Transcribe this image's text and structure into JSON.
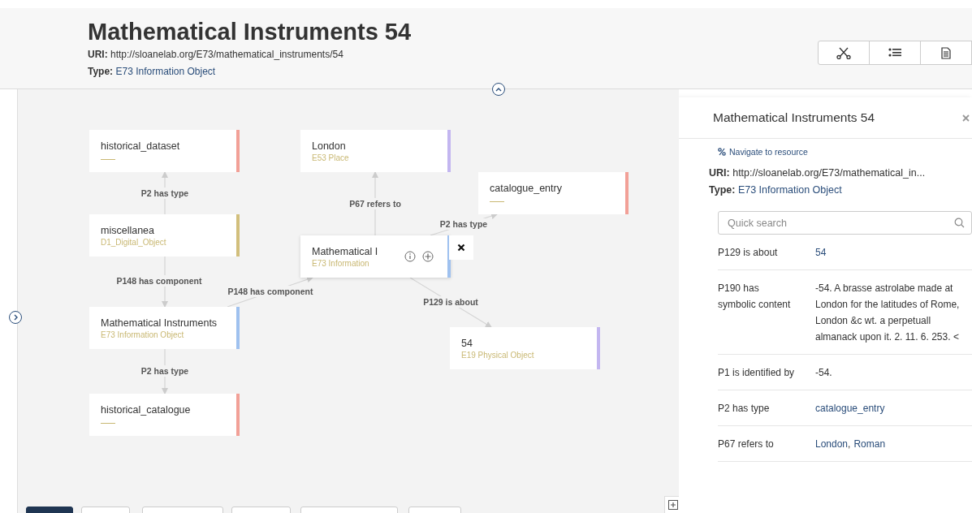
{
  "header": {
    "title": "Mathematical Instruments 54",
    "uri_label": "URI:",
    "uri": "http://sloanelab.org/E73/mathematical_instruments/54",
    "type_label": "Type:",
    "type": "E73 Information Object"
  },
  "view_buttons": [
    {
      "kind": "graph",
      "selected": false
    },
    {
      "kind": "list",
      "selected": false
    },
    {
      "kind": "document",
      "selected": false
    }
  ],
  "graph": {
    "nodes": [
      {
        "label": "historical_dataset",
        "color": "#f2a097"
      },
      {
        "label": "London",
        "type": "E53 Place",
        "color": "#c3b6f0"
      },
      {
        "label": "catalogue_entry",
        "color": "#f2a097"
      },
      {
        "label": "miscellanea",
        "type": "D1_Digital_Object",
        "color": "#d2bf7c"
      },
      {
        "label": "Mathematical I",
        "type": "E73 Information",
        "color": "#9fc1ef",
        "selected": true
      },
      {
        "label": "Mathematical Instruments",
        "type": "E73 Information Object",
        "color": "#9fc1ef"
      },
      {
        "label": "54",
        "type": "E19 Physical Object",
        "color": "#c3b6f0"
      },
      {
        "label": "historical_catalogue",
        "color": "#f2a097"
      }
    ],
    "edges": [
      {
        "label": "P2 has type"
      },
      {
        "label": "P67 refers to"
      },
      {
        "label": "P2 has type"
      },
      {
        "label": "P148 has component"
      },
      {
        "label": "P148 has component"
      },
      {
        "label": "P129 is about"
      },
      {
        "label": "P2 has type"
      }
    ]
  },
  "panel": {
    "title": "Mathematical Instruments 54",
    "navigate": "Navigate to resource",
    "uri_label": "URI:",
    "uri": "http://sloanelab.org/E73/mathematical_in...",
    "type_label": "Type:",
    "type": "E73 Information Object",
    "search": {
      "placeholder": "Quick search"
    },
    "rows": [
      {
        "property": "P129 is about",
        "values": [
          {
            "text": "54",
            "link": true
          }
        ]
      },
      {
        "property": "P190 has symbolic content",
        "values": [
          {
            "text": "-54. A brasse astrolabe made at London for the latitudes of Rome, London &c wt. a perpetuall almanack upon it. 2. 11. 6. 253. <",
            "link": false
          }
        ]
      },
      {
        "property": "P1 is identified by",
        "values": [
          {
            "text": "-54.",
            "link": false
          }
        ]
      },
      {
        "property": "P2 has type",
        "values": [
          {
            "text": "catalogue_entry",
            "link": true
          }
        ]
      },
      {
        "property": "P67 refers to",
        "separator": ",",
        "values": [
          {
            "text": "London",
            "link": true
          },
          {
            "text": "Roman",
            "link": true
          }
        ]
      }
    ]
  }
}
